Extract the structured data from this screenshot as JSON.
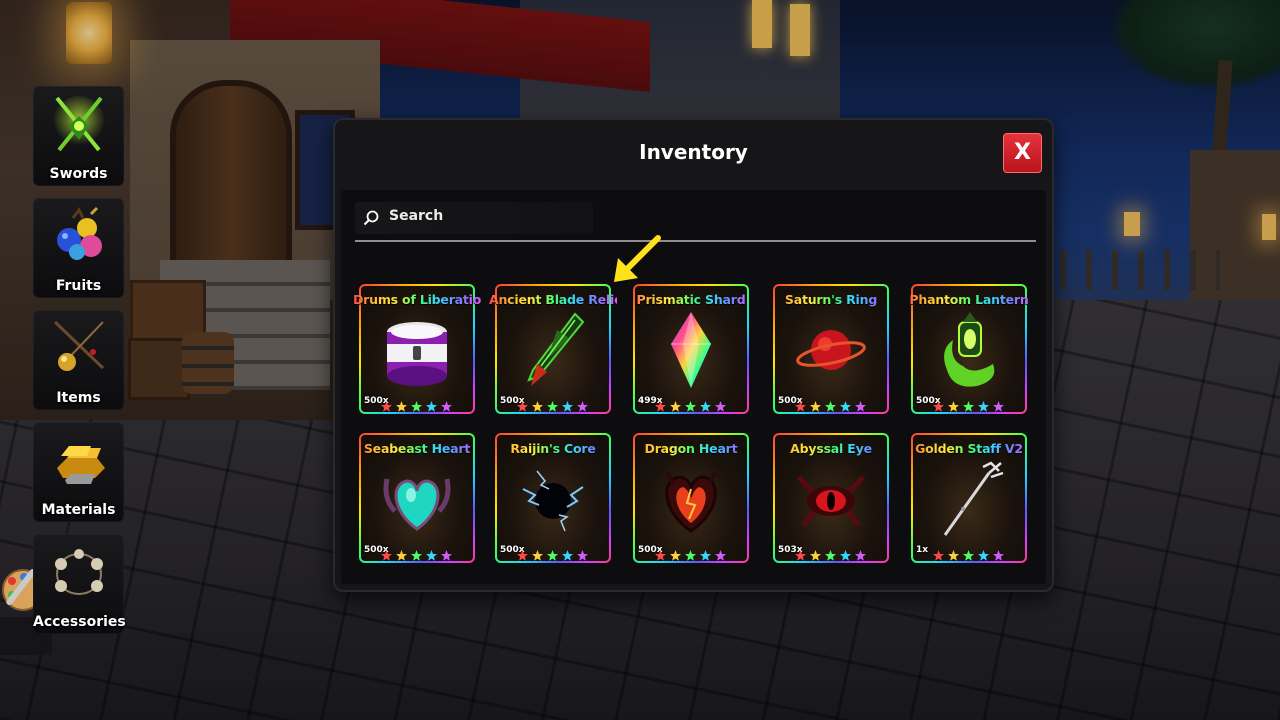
{
  "sidebar": {
    "items": [
      {
        "label": "Swords",
        "icon": "crossed-swords-icon"
      },
      {
        "label": "Fruits",
        "icon": "devil-fruits-icon"
      },
      {
        "label": "Items",
        "icon": "rod-and-orb-icon"
      },
      {
        "label": "Materials",
        "icon": "gold-ingot-icon"
      },
      {
        "label": "Accessories",
        "icon": "bead-necklace-icon"
      }
    ]
  },
  "inventory": {
    "title": "Inventory",
    "close_label": "X",
    "search": {
      "placeholder": "Search"
    },
    "items": [
      {
        "name": "Drums of Liberation",
        "qty": "500x",
        "icon": "drum-icon",
        "stars": 5
      },
      {
        "name": "Ancient Blade Relic",
        "qty": "500x",
        "icon": "green-blade-relic-icon",
        "stars": 5
      },
      {
        "name": "Prismatic Shard",
        "qty": "499x",
        "icon": "rainbow-crystal-icon",
        "stars": 5
      },
      {
        "name": "Saturn's Ring",
        "qty": "500x",
        "icon": "red-ringed-planet-icon",
        "stars": 5
      },
      {
        "name": "Phantom Lantern",
        "qty": "500x",
        "icon": "green-flame-lantern-icon",
        "stars": 5
      },
      {
        "name": "Seabeast Heart",
        "qty": "500x",
        "icon": "teal-heart-tentacles-icon",
        "stars": 5
      },
      {
        "name": "Raijin's Core",
        "qty": "500x",
        "icon": "lightning-orb-icon",
        "stars": 5
      },
      {
        "name": "Dragon Heart",
        "qty": "500x",
        "icon": "fiery-dragon-heart-icon",
        "stars": 5
      },
      {
        "name": "Abyssal Eye",
        "qty": "503x",
        "icon": "red-abyssal-eye-icon",
        "stars": 5
      },
      {
        "name": "Golden Staff V2",
        "qty": "1x",
        "icon": "silver-trident-staff-icon",
        "stars": 5
      }
    ]
  },
  "colors": {
    "close_red": "#d81f28",
    "panel": "#161618",
    "arrow_yellow": "#ffe21a"
  }
}
